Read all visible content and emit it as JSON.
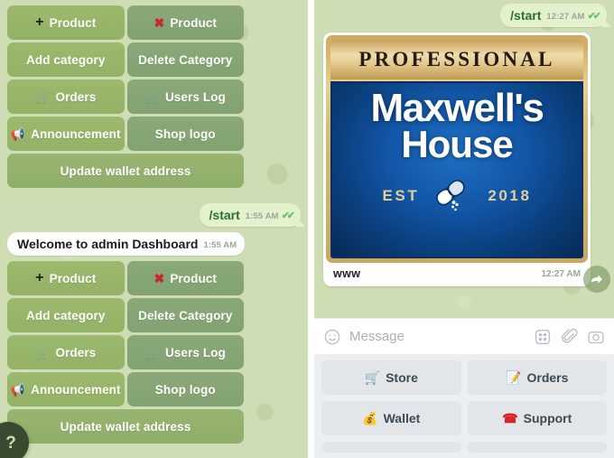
{
  "left_panel": {
    "keyboard_top": {
      "rows": [
        [
          {
            "icon": "plus-icon",
            "icon_glyph": "+",
            "label": "Product",
            "side": "left"
          },
          {
            "icon": "cross-mark-icon",
            "icon_glyph": "✖",
            "label": "Product",
            "side": "right"
          }
        ],
        [
          {
            "icon": "",
            "icon_glyph": "",
            "label": "Add category",
            "side": "left"
          },
          {
            "icon": "",
            "icon_glyph": "",
            "label": "Delete Category",
            "side": "right"
          }
        ],
        [
          {
            "icon": "shopping-cart-icon",
            "icon_glyph": "🛒",
            "label": "Orders",
            "side": "left"
          },
          {
            "icon": "shopping-cart-icon",
            "icon_glyph": "🛒",
            "label": "Users Log",
            "side": "right"
          }
        ],
        [
          {
            "icon": "loudspeaker-icon",
            "icon_glyph": "📢",
            "label": "Announcement",
            "side": "left"
          },
          {
            "icon": "",
            "icon_glyph": "",
            "label": "Shop logo",
            "side": "right"
          }
        ]
      ],
      "wide_button": {
        "label": "Update wallet address"
      }
    },
    "message_out": {
      "text": "/start",
      "time": "1:55 AM",
      "ticks": "✔✔"
    },
    "message_in": {
      "text": "Welcome to admin Dashboard",
      "time": "1:55 AM"
    },
    "keyboard_bottom": {
      "rows": [
        [
          {
            "icon": "plus-icon",
            "icon_glyph": "+",
            "label": "Product",
            "side": "left"
          },
          {
            "icon": "cross-mark-icon",
            "icon_glyph": "✖",
            "label": "Product",
            "side": "right"
          }
        ],
        [
          {
            "icon": "",
            "icon_glyph": "",
            "label": "Add category",
            "side": "left"
          },
          {
            "icon": "",
            "icon_glyph": "",
            "label": "Delete Category",
            "side": "right"
          }
        ],
        [
          {
            "icon": "shopping-cart-icon",
            "icon_glyph": "🛒",
            "label": "Orders",
            "side": "left"
          },
          {
            "icon": "shopping-cart-icon",
            "icon_glyph": "🛒",
            "label": "Users Log",
            "side": "right"
          }
        ],
        [
          {
            "icon": "loudspeaker-icon",
            "icon_glyph": "📢",
            "label": "Announcement",
            "side": "left"
          },
          {
            "icon": "",
            "icon_glyph": "",
            "label": "Shop logo",
            "side": "right"
          }
        ]
      ],
      "wide_button": {
        "label": "Update wallet address"
      }
    },
    "fab": {
      "icon": "help-question-icon",
      "glyph": "?"
    }
  },
  "right_panel": {
    "message_out": {
      "text": "/start",
      "time": "12:27 AM",
      "ticks": "✔✔"
    },
    "image_message": {
      "logo": {
        "banner_text": "PROFESSIONAL",
        "brand_line1": "Maxwell's",
        "brand_line2": "House",
        "est_label": "EST",
        "est_year": "2018",
        "emblem": "pill-capsule-icon"
      },
      "caption": "www",
      "time": "12:27 AM",
      "forward_button": "forward-arrow-icon"
    },
    "input_bar": {
      "emoji_icon": "smiley-face-icon",
      "placeholder": "Message",
      "sticker_icon": "sticker-grid-icon",
      "attach_icon": "paperclip-icon",
      "camera_icon": "camera-icon"
    },
    "bottom_keyboard": {
      "rows": [
        [
          {
            "icon": "shopping-cart-icon",
            "icon_glyph": "🛒",
            "label": "Store"
          },
          {
            "icon": "memo-pencil-icon",
            "icon_glyph": "📝",
            "label": "Orders"
          }
        ],
        [
          {
            "icon": "money-wallet-icon",
            "icon_glyph": "💰",
            "label": "Wallet"
          },
          {
            "icon": "telephone-icon",
            "icon_glyph": "☎",
            "label": "Support"
          }
        ]
      ]
    }
  },
  "colors": {
    "chat_background": "#cfddb4",
    "outgoing_bubble": "#e3f2cd",
    "incoming_bubble": "#ffffff",
    "keyboard_left_button": "#9cb96d",
    "keyboard_right_button": "#8aa878",
    "logo_gold": "#e2c88c",
    "logo_blue": "#1257a8",
    "tick_green": "#6fbf73",
    "bottom_keyboard_bg": "#eceff1"
  }
}
